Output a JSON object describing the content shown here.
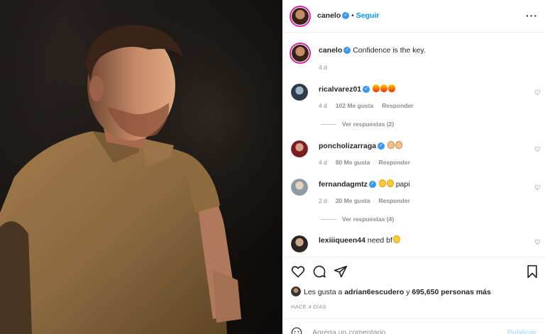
{
  "header": {
    "username": "canelo",
    "follow_label": "Seguir",
    "more_icon": "more-options-icon"
  },
  "caption": {
    "username": "canelo",
    "text": "Confidence is the key.",
    "age": "4 d"
  },
  "comments": [
    {
      "username": "ricalvarez01",
      "verified": true,
      "text": "",
      "emojis": [
        "fire",
        "fire",
        "fire"
      ],
      "age": "4 d",
      "likes": "102 Me gusta",
      "reply": "Responder",
      "view_replies": "Ver respuestas (2)"
    },
    {
      "username": "poncholizarraga",
      "verified": true,
      "text": "",
      "emojis": [
        "flexed-biceps",
        "ok-hand"
      ],
      "age": "4 d",
      "likes": "80 Me gusta",
      "reply": "Responder"
    },
    {
      "username": "fernandagmtz",
      "verified": true,
      "text": "papi",
      "emojis": [
        "grin",
        "grin"
      ],
      "age": "2 d",
      "likes": "30 Me gusta",
      "reply": "Responder",
      "view_replies": "Ver respuestas (4)"
    },
    {
      "username": "lexiiiqueen44",
      "verified": false,
      "text": "need bf",
      "emojis": [
        "smiling-face"
      ]
    }
  ],
  "likes": {
    "prefix": "Les gusta a",
    "user": "adrian6escudero",
    "connector": "y",
    "count": "695,650 personas más"
  },
  "timestamp": "HACE 4 DÍAS",
  "add_comment": {
    "placeholder": "Agrega un comentario...",
    "publish_label": "Publicar"
  },
  "colors": {
    "accent": "#0095f6",
    "verified": "#3897f0",
    "publish_disabled": "#b2dffc",
    "muted": "#8e8e8e"
  }
}
